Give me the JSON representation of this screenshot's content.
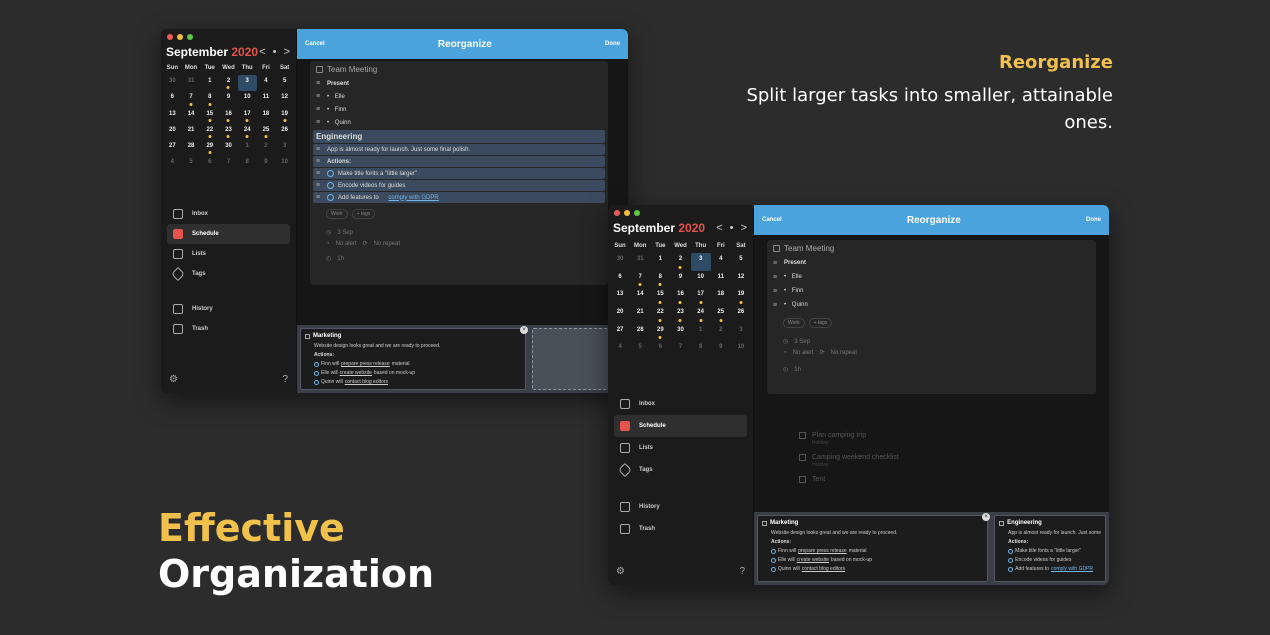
{
  "marketing": {
    "headline_1": "Effective",
    "headline_2": "Organization",
    "feature_title": "Reorganize",
    "feature_desc": "Split larger tasks into smaller, attainable ones."
  },
  "calendar": {
    "month": "September",
    "year": "2020",
    "nav": "< • >",
    "weekdays": [
      "Sun",
      "Mon",
      "Tue",
      "Wed",
      "Thu",
      "Fri",
      "Sat"
    ],
    "days": [
      "30",
      "31",
      "1",
      "2",
      "3",
      "4",
      "5",
      "6",
      "7",
      "8",
      "9",
      "10",
      "11",
      "12",
      "13",
      "14",
      "15",
      "16",
      "17",
      "18",
      "19",
      "20",
      "21",
      "22",
      "23",
      "24",
      "25",
      "26",
      "27",
      "28",
      "29",
      "30",
      "1",
      "2",
      "3",
      "4",
      "5",
      "6",
      "7",
      "8",
      "9",
      "10"
    ]
  },
  "sidebar": {
    "items": [
      {
        "label": "Inbox"
      },
      {
        "label": "Schedule"
      },
      {
        "label": "Lists"
      },
      {
        "label": "Tags"
      },
      {
        "label": "History"
      },
      {
        "label": "Trash"
      }
    ]
  },
  "topbar": {
    "cancel": "Cancel",
    "title": "Reorganize",
    "done": "Done"
  },
  "task": {
    "title": "Team Meeting",
    "present": "Present",
    "people": [
      "Elle",
      "Finn",
      "Quinn"
    ],
    "engineering": "Engineering",
    "eng_note": "App is almost ready for launch. Just some final polish.",
    "actions": "Actions:",
    "eng_items": [
      "Make title fonts a \"little larger\"",
      "Encode videos for guides",
      "Add features to"
    ],
    "eng_link": "comply with GDPR",
    "tag_work": "Work",
    "tag_add": "+ tags",
    "date": "3 Sep",
    "alert": "No alert",
    "repeat": "No repeat",
    "duration": "1h"
  },
  "background_tasks": [
    "Plan camping trip",
    "Camping weekend checklist",
    "Tent"
  ],
  "background_sub": "Holiday",
  "marketing_note": {
    "title": "Marketing",
    "line": "Website design looks great and we are ready to proceed.",
    "actions": "Actions:",
    "item1_pre": "Finn will ",
    "item1_link": "prepare press release",
    "item1_post": " material",
    "item2_pre": "Elle will ",
    "item2_link": "create website",
    "item2_post": " based on mock-up",
    "item3_pre": "Quinn will ",
    "item3_link": "contact blog editors"
  },
  "engineering_note": {
    "title": "Engineering",
    "line": "App is almost ready for launch. Just some",
    "actions": "Actions:",
    "item1": "Make title fonts a \"little larger\"",
    "item2": "Encode videos for guides",
    "item3_pre": "Add features to ",
    "item3_link": "comply with GDPR"
  },
  "icons": [
    "calendar-icon",
    "inbox-icon",
    "list-icon",
    "tag-icon",
    "history-icon",
    "trash-icon",
    "settings-icon",
    "help-icon"
  ]
}
